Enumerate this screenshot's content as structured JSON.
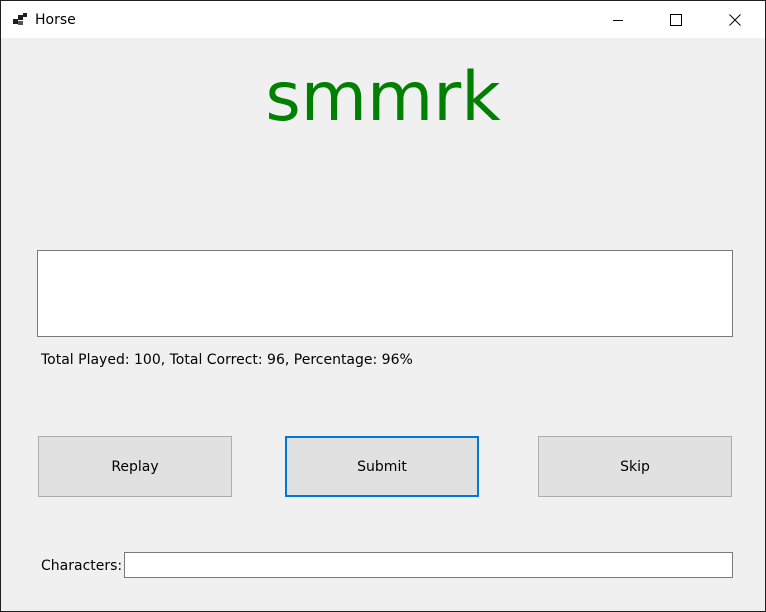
{
  "window": {
    "title": "Horse",
    "icon": "app-icon"
  },
  "main": {
    "word": "smmrk",
    "word_color": "#008000",
    "answer_value": "",
    "stats": "Total Played: 100, Total Correct: 96, Percentage: 96%"
  },
  "buttons": {
    "replay": "Replay",
    "submit": "Submit",
    "skip": "Skip"
  },
  "characters": {
    "label": "Characters:",
    "value": ""
  },
  "colors": {
    "focus_border": "#0078d7",
    "background": "#f0f0f0"
  }
}
